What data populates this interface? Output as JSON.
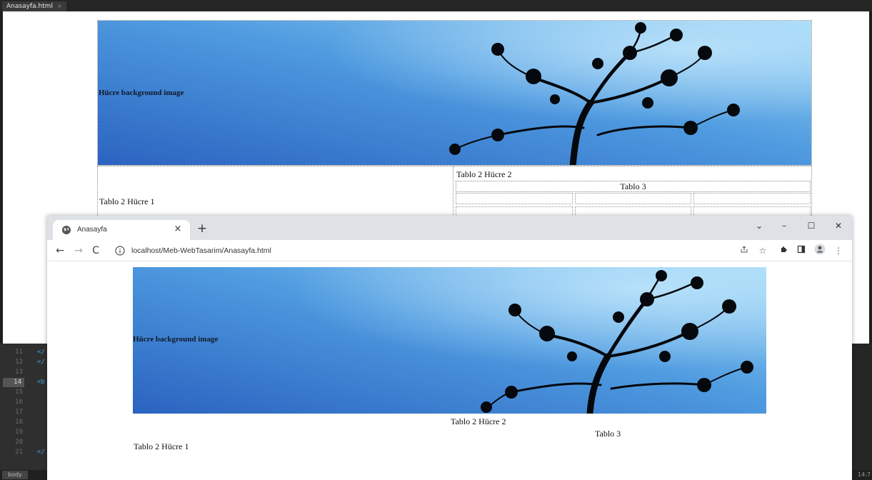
{
  "editor": {
    "file_tab": "Anasayfa.html",
    "tab_close": "×",
    "line_numbers": [
      "11",
      "12",
      "13",
      "14",
      "15",
      "16",
      "17",
      "18",
      "19",
      "20",
      "21"
    ],
    "code_fragments": [
      "</",
      "</",
      "<b",
      "</"
    ],
    "status_tag": "body",
    "status_position": "14:7"
  },
  "design": {
    "hero_text": "Hücre background image",
    "table2_cell1": "Tablo 2 Hücre 1",
    "table2_cell2": "Tablo 2 Hücre 2",
    "table3_title": "Tablo 3"
  },
  "browser": {
    "tab_title": "Anasayfa",
    "tab_close": "×",
    "new_tab": "+",
    "url": "localhost/Meb-WebTasarim/Anasayfa.html",
    "window_controls": {
      "dropdown": "⌄",
      "minimize": "–",
      "maximize": "☐",
      "close": "✕"
    },
    "nav": {
      "back": "←",
      "forward": "→",
      "reload": "C"
    }
  },
  "page": {
    "hero_text": "Hücre background image",
    "table2_cell2": "Tablo 2 Hücre 2",
    "table3_title": "Tablo 3",
    "table2_cell1": "Tablo 2 Hücre 1"
  },
  "colors": {
    "sky_light": "#8fd0f4",
    "sky_dark": "#2b63c0",
    "editor_bg": "#2a2a2a",
    "chrome_tabstrip": "#dee1e6"
  }
}
